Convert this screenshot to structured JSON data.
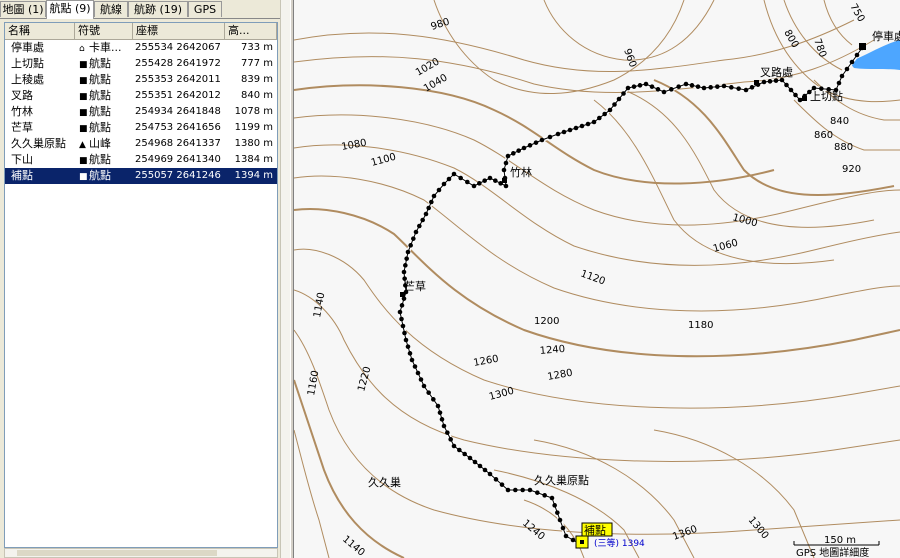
{
  "tabs": [
    {
      "label": "地圖 (1)",
      "active": false
    },
    {
      "label": "航點 (9)",
      "active": true
    },
    {
      "label": "航線",
      "active": false
    },
    {
      "label": "航跡 (19)",
      "active": false
    },
    {
      "label": "GPS",
      "active": false
    }
  ],
  "columns": [
    "名稱",
    "符號",
    "座標",
    "高..."
  ],
  "waypoints": [
    {
      "name": "停車處",
      "symbol": "卡車...",
      "symbol_icon": "truck-icon",
      "coord": "255534 2642067",
      "alt": "733 m",
      "selected": false
    },
    {
      "name": "上切點",
      "symbol": "航點",
      "symbol_icon": "waypoint-icon",
      "coord": "255428 2641972",
      "alt": "777 m",
      "selected": false
    },
    {
      "name": "上稜處",
      "symbol": "航點",
      "symbol_icon": "waypoint-icon",
      "coord": "255353 2642011",
      "alt": "839 m",
      "selected": false
    },
    {
      "name": "叉路",
      "symbol": "航點",
      "symbol_icon": "waypoint-icon",
      "coord": "255351 2642012",
      "alt": "840 m",
      "selected": false
    },
    {
      "name": "竹林",
      "symbol": "航點",
      "symbol_icon": "waypoint-icon",
      "coord": "254934 2641848",
      "alt": "1078 m",
      "selected": false
    },
    {
      "name": "芒草",
      "symbol": "航點",
      "symbol_icon": "waypoint-icon",
      "coord": "254753 2641656",
      "alt": "1199 m",
      "selected": false
    },
    {
      "name": "久久巢原點",
      "symbol": "山峰",
      "symbol_icon": "summit-icon",
      "coord": "254968 2641337",
      "alt": "1380 m",
      "selected": false
    },
    {
      "name": "下山",
      "symbol": "航點",
      "symbol_icon": "waypoint-icon",
      "coord": "254969 2641340",
      "alt": "1384 m",
      "selected": false
    },
    {
      "name": "補點",
      "symbol": "航點",
      "symbol_icon": "waypoint-icon",
      "coord": "255057 2641246",
      "alt": "1394 m",
      "selected": true
    }
  ],
  "map": {
    "contour_labels": [
      "980",
      "960",
      "1020",
      "1040",
      "1080",
      "1100",
      "1140",
      "1160",
      "1220",
      "1200",
      "1260",
      "1240",
      "1280",
      "1300",
      "1120",
      "1180",
      "1000",
      "1060",
      "920",
      "880",
      "860",
      "840",
      "800",
      "780",
      "750",
      "1240",
      "1140",
      "1300",
      "1360"
    ],
    "waypoint_labels": [
      "停車處",
      "叉路處",
      "上切點",
      "竹林",
      "芒草",
      "久久巢原點",
      "補點"
    ],
    "place_label": "久久巢",
    "benchmark_label": "(三等) 1394",
    "scale_label": "150 m",
    "detail_label": "GPS 地圖詳細度",
    "contour_color": "#b08c60",
    "track_color": "#000000",
    "water_color": "#4da6ff",
    "selection_color": "#ffff00"
  }
}
